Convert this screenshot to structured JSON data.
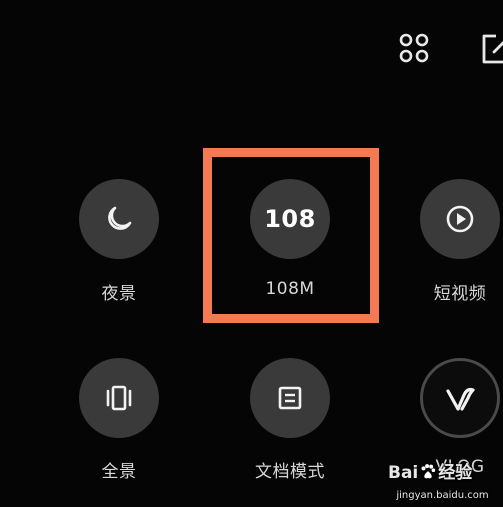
{
  "toolbar": {
    "grid_icon": "grid-icon",
    "edit_icon": "edit-icon"
  },
  "modes": [
    {
      "key": "night",
      "icon": "moon-icon",
      "label": "夜景"
    },
    {
      "key": "108m",
      "icon_text": "108",
      "label": "108M",
      "highlighted": true
    },
    {
      "key": "short-video",
      "icon": "play-icon",
      "label": "短视频"
    },
    {
      "key": "panorama",
      "icon": "panorama-icon",
      "label": "全景"
    },
    {
      "key": "document",
      "icon": "document-icon",
      "label": "文档模式"
    },
    {
      "key": "vlog",
      "icon": "vlog-icon",
      "label": "VLOG"
    }
  ],
  "highlight_color": "#f47a53",
  "watermark": {
    "brand_left": "Bai",
    "brand_right": "经验",
    "url": "jingyan.baidu.com"
  }
}
